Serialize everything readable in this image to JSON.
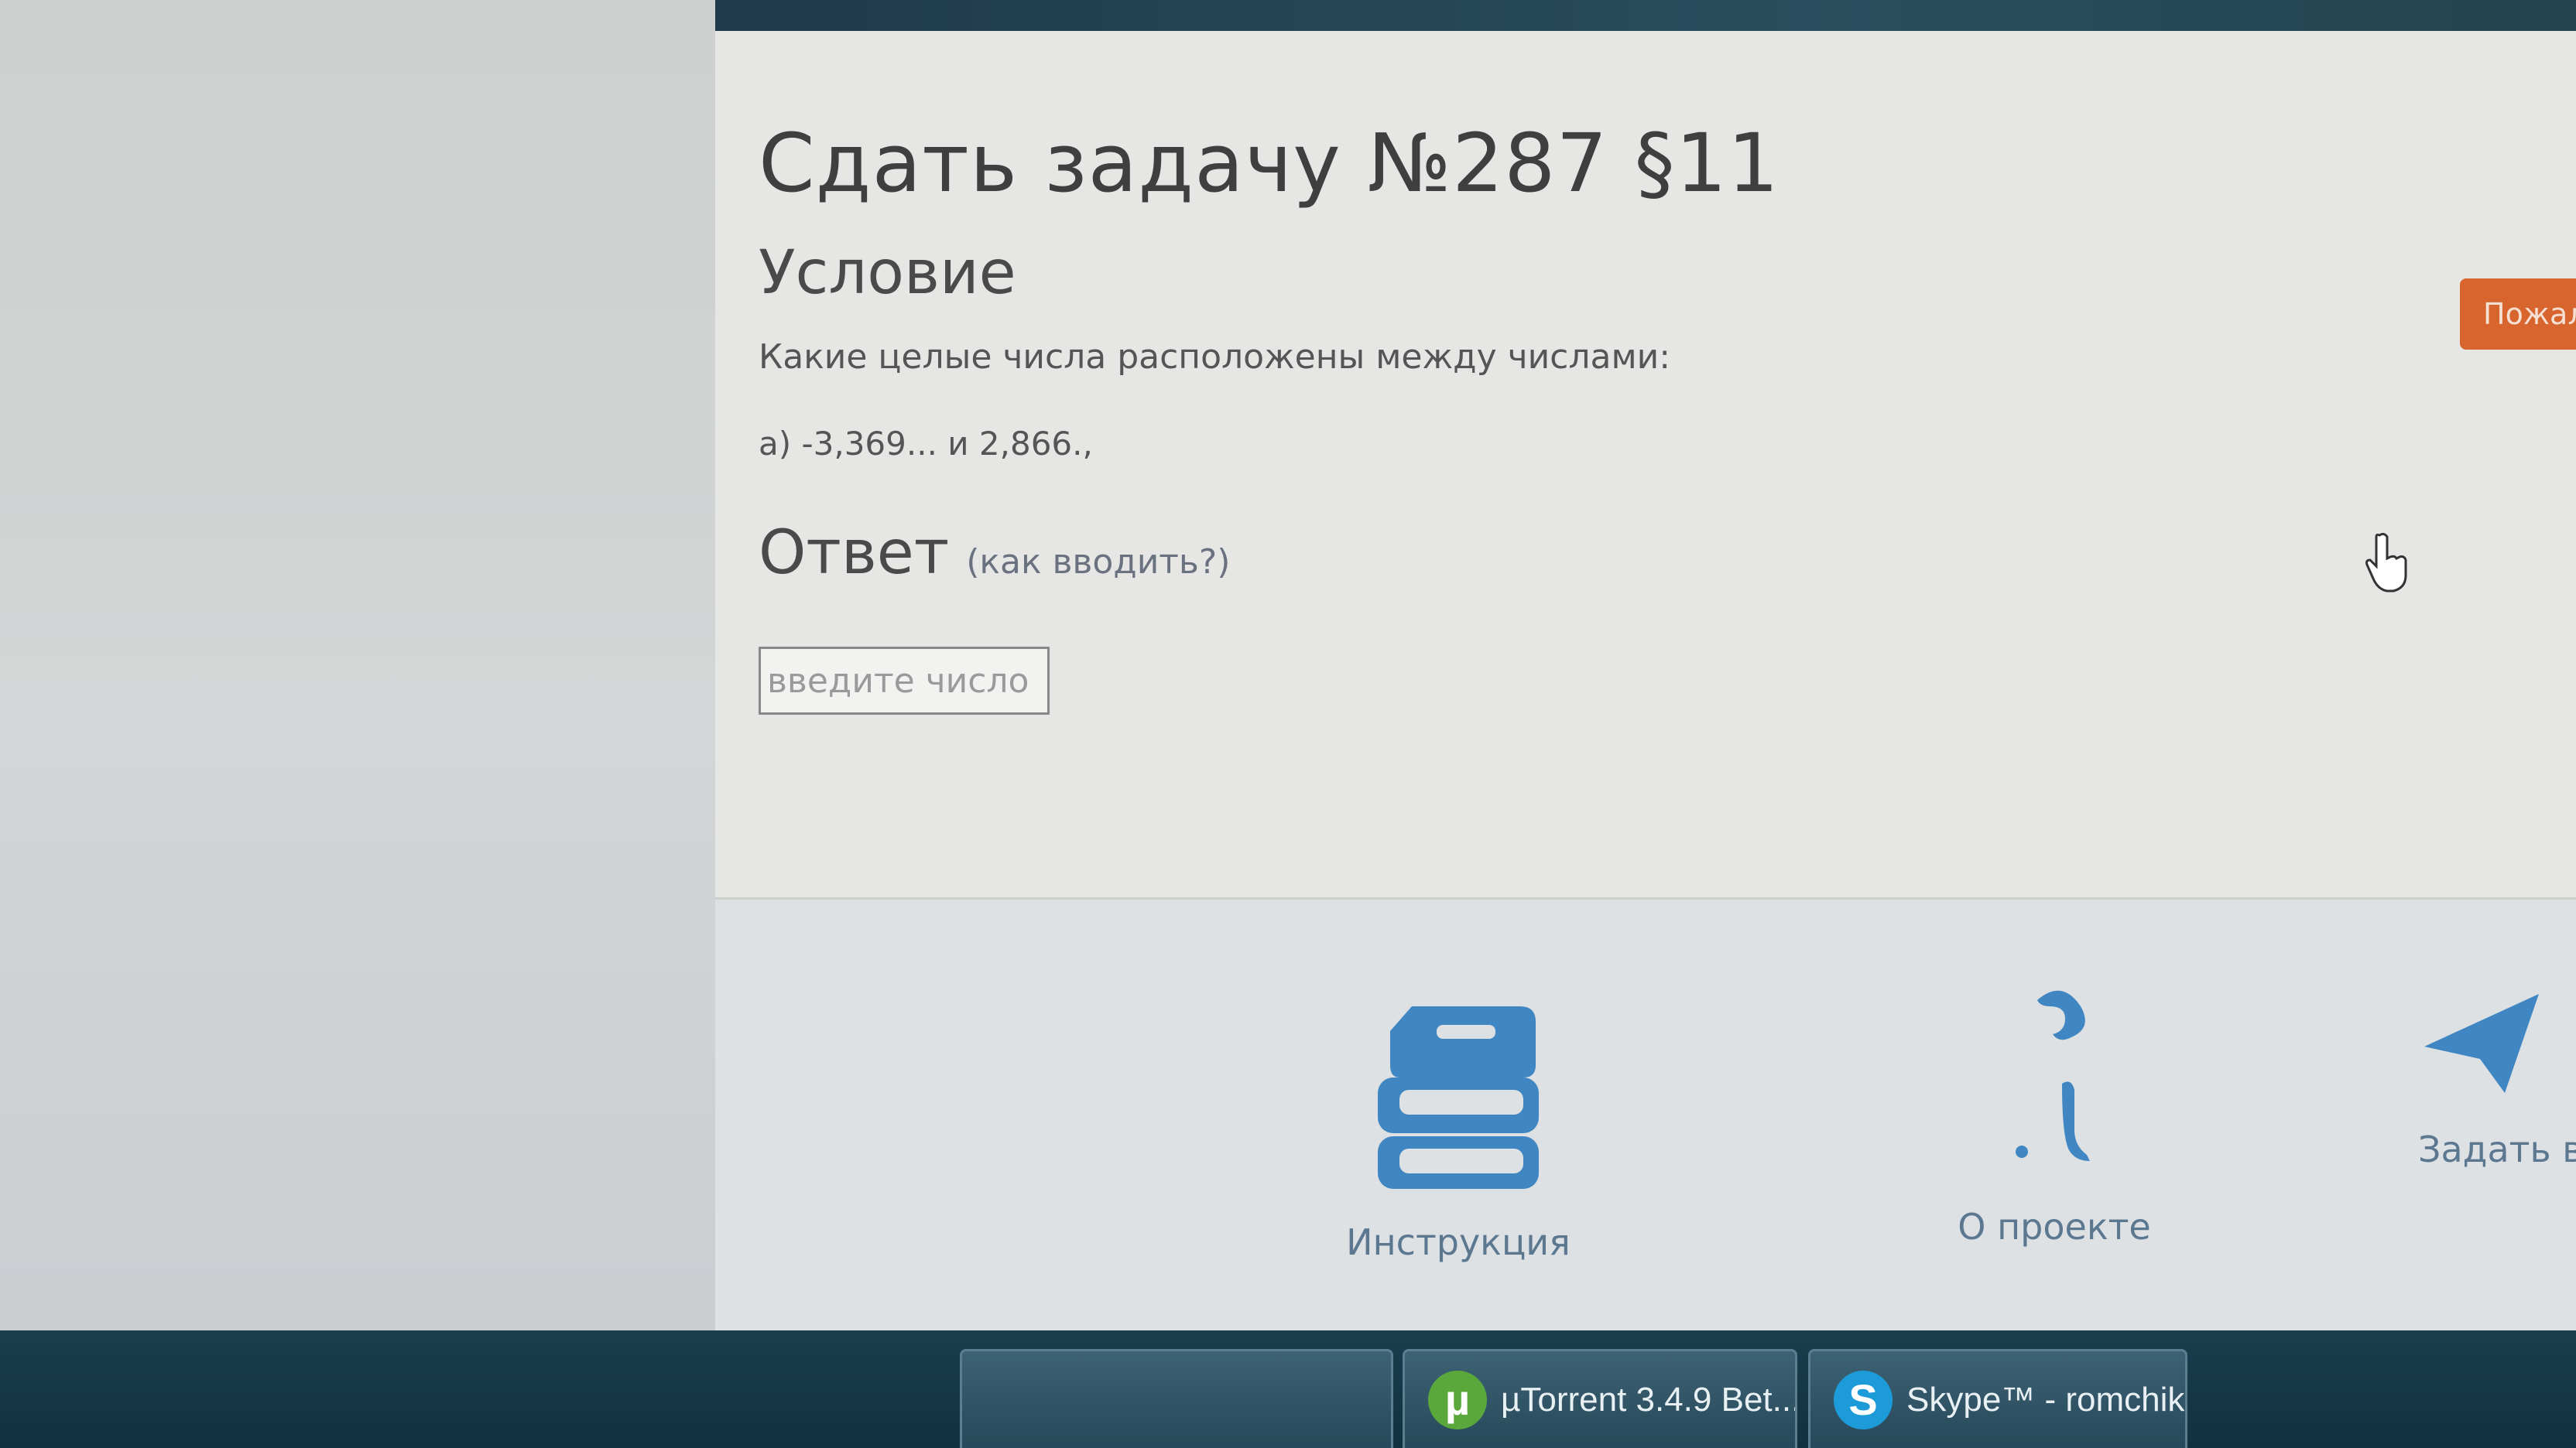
{
  "page": {
    "title": "Сдать задачу №287 §11",
    "condition_heading": "Условие",
    "condition_text": "Какие целые числа расположены между числами:",
    "condition_item": "а) -3,369... и 2,866.,",
    "answer_heading": "Ответ",
    "howto_link": "(как вводить?)",
    "answer_placeholder": "введите число",
    "complain_label": "Пожал"
  },
  "footer": {
    "items": [
      {
        "label": "Инструкция",
        "icon": "books-icon"
      },
      {
        "label": "О проекте",
        "icon": "question-figure-icon"
      },
      {
        "label": "Задать в",
        "icon": "paper-plane-icon"
      }
    ]
  },
  "taskbar": {
    "items": [
      {
        "label": "",
        "icon": "app-icon"
      },
      {
        "label": "µTorrent 3.4.9 Bet...",
        "icon": "utorrent-icon",
        "icon_glyph": "µ"
      },
      {
        "label": "Skype™ - romchik...",
        "icon": "skype-icon",
        "icon_glyph": "S"
      }
    ]
  },
  "colors": {
    "accent_orange": "#d8652d",
    "footer_icon_blue": "#3f86c2",
    "footer_text": "#5c7891",
    "taskbar": "#1b3d4d"
  }
}
